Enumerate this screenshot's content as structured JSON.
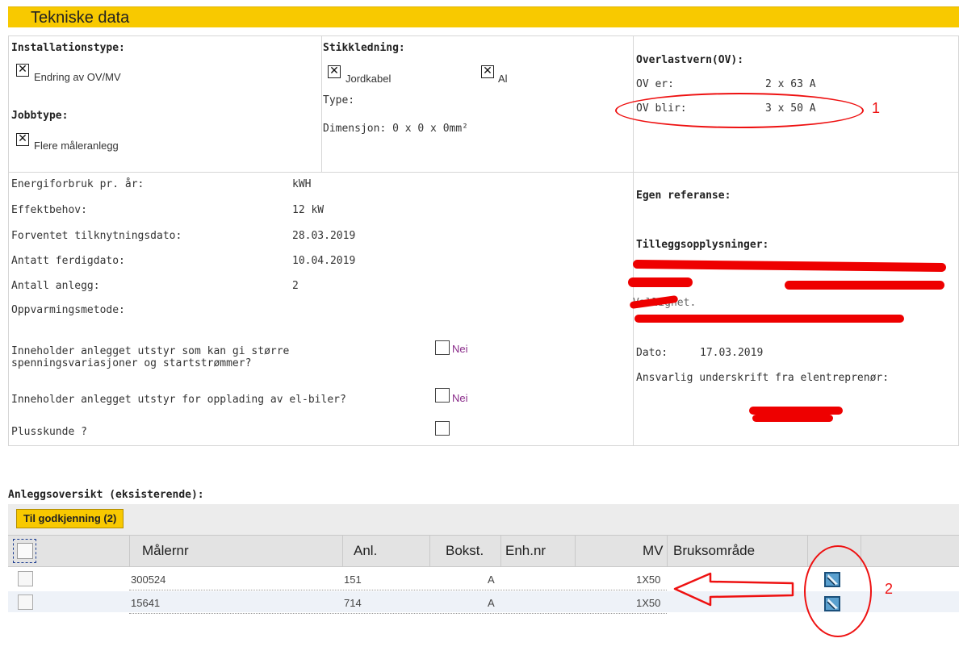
{
  "title": "Tekniske data",
  "installation": {
    "label": "Installationstype:",
    "option": "Endring av OV/MV"
  },
  "job": {
    "label": "Jobbtype:",
    "option": "Flere måleranlegg"
  },
  "stikk": {
    "label": "Stikkledning:",
    "opt1": "Jordkabel",
    "opt2": "Al",
    "type_label": "Type:",
    "dim": "Dimensjon: 0 x 0 x 0mm²"
  },
  "ov": {
    "label": "Overlastvern(OV):",
    "er_label": "OV er:",
    "er_value": "2 x 63 A",
    "blir_label": "OV blir:",
    "blir_value": "3 x 50 A"
  },
  "energy": {
    "rows": [
      {
        "label": "Energiforbruk pr. år:",
        "value": "kWH"
      },
      {
        "label": "Effektbehov:",
        "value": "12 kW"
      },
      {
        "label": "Forventet tilknytningsdato:",
        "value": "28.03.2019"
      },
      {
        "label": "Antatt ferdigdato:",
        "value": "10.04.2019"
      },
      {
        "label": "Antall anlegg:",
        "value": "2"
      },
      {
        "label": "Oppvarmingsmetode:",
        "value": ""
      }
    ]
  },
  "questions": {
    "q1": "Inneholder anlegget utstyr som kan gi større spenningsvariasjoner og startstrømmer?",
    "q1_ans": "Nei",
    "q2": "Inneholder anlegget utstyr for opplading av el-biler?",
    "q2_ans": "Nei",
    "q3": "Plusskunde ?"
  },
  "right": {
    "ref_label": "Egen referanse:",
    "info_label": "Tilleggsopplysninger:",
    "info_tail": "Vallighet.",
    "date_label": "Dato:",
    "date_value": "17.03.2019",
    "sign_label": "Ansvarlig underskrift fra elentreprenør:"
  },
  "overview": {
    "label": "Anleggsoversikt (eksisterende):",
    "button": "Til godkjenning (2)",
    "headers": {
      "maler": "Målernr",
      "anl": "Anl.",
      "bokst": "Bokst.",
      "enh": "Enh.nr",
      "mv": "MV",
      "bruk": "Bruksområde"
    },
    "rows": [
      {
        "maler": "300524",
        "anl": "151",
        "bokst": "A",
        "enh": "",
        "mv": "1X50"
      },
      {
        "maler": "15641",
        "anl": "714",
        "bokst": "A",
        "enh": "",
        "mv": "1X50"
      }
    ]
  },
  "annotations": {
    "a1": "1",
    "a2": "2"
  }
}
